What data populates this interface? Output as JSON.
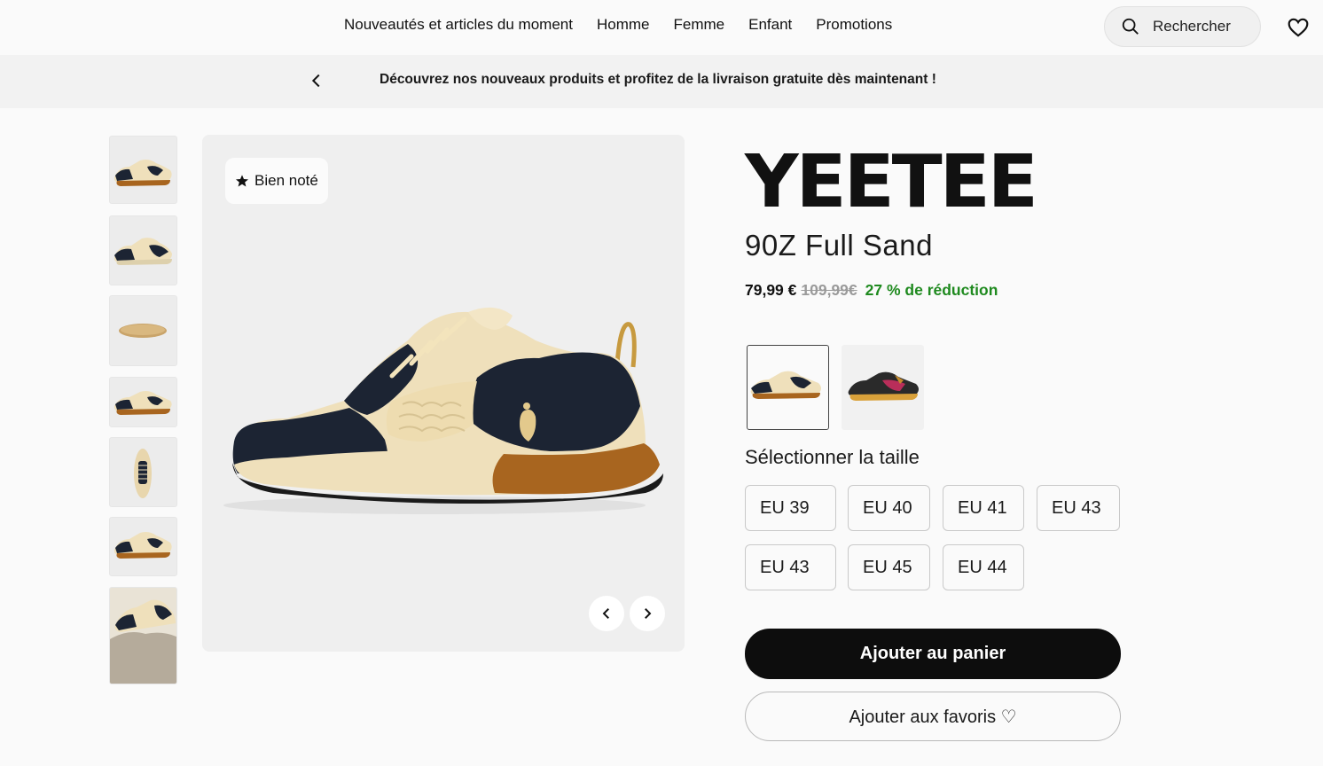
{
  "nav": {
    "links": [
      "Nouveautés et articles du moment",
      "Homme",
      "Femme",
      "Enfant",
      "Promotions"
    ],
    "search_label": "Rechercher"
  },
  "banner": {
    "text": "Découvrez nos nouveaux produits et profitez de la livraison gratuite dès maintenant !"
  },
  "gallery": {
    "badge": "Bien noté",
    "thumbnail_count": 7
  },
  "product": {
    "brand": "YEETEE",
    "model": "90Z Full Sand",
    "price": "79,99 €",
    "old_price": "109,99€",
    "discount": "27 % de réduction"
  },
  "sizes": {
    "title": "Sélectionner la taille",
    "options": [
      "EU 39",
      "EU 40",
      "EU 41",
      "EU 43",
      "EU 43",
      "EU 45",
      "EU 44"
    ]
  },
  "actions": {
    "add_to_cart": "Ajouter au panier",
    "add_to_favorites": "Ajouter aux favoris ♡"
  },
  "colors": {
    "navy": "#1c2433",
    "sand": "#efe0bb",
    "sole_brown": "#a8651f",
    "discount_green": "#1f8a1f"
  }
}
